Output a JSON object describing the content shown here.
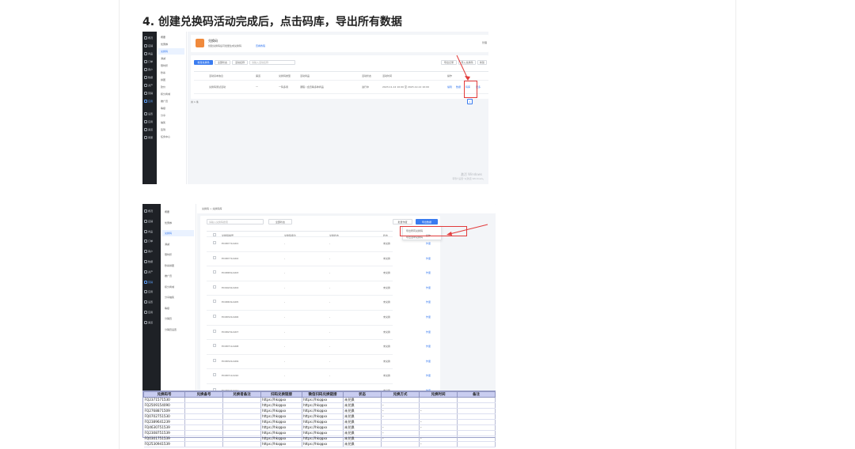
{
  "step_title": "4. 创建兑换码活动完成后，点击码库，导出所有数据",
  "shot1": {
    "nav": [
      "概况",
      "店铺",
      "商品",
      "订单",
      "客户",
      "数据",
      "资产",
      "营销",
      "应用"
    ],
    "nav_active": 8,
    "nav_bottom": [
      "设置",
      "应用",
      "渠道",
      "客服"
    ],
    "subnav": [
      "概要",
      "优惠券",
      "兑换码",
      "满减",
      "限时折",
      "秒杀",
      "拼团",
      "砍价",
      "积分商城",
      "推广员",
      "等级",
      "分享",
      "抽奖",
      "签到",
      "任务中心"
    ],
    "subnav_active": 2,
    "header_title": "兑换码",
    "header_desc": "创建兑换码后可批量生成兑换码",
    "header_link": "查看教程",
    "header_right": "管理",
    "tab_active": "新建兑换码",
    "tab_2": "全部状态",
    "filter_1": "活动名称",
    "search_placeholder": "请输入活动名称",
    "btn_export": "导出记录",
    "btn_import": "导入兑换码",
    "btn_new": "新建",
    "columns": [
      "活动基本信息",
      "渠道",
      "兑换码类型",
      "活动商品",
      "活动状态",
      "活动时间",
      "操作"
    ],
    "row": [
      "兑换码测试活动",
      "一",
      "一码多用",
      "课程 / 会员等多种商品",
      "进行中",
      "2023-11-12 10:00 至 2023-12-12 10:00"
    ],
    "row_actions": [
      "编辑",
      "数据",
      "码库",
      "更多"
    ],
    "pagination": "共 1 条",
    "page_num": "1",
    "watermark_1": "激活 Windows",
    "watermark_2": "转到“设置”以激活 Windows。"
  },
  "shot2": {
    "breadcrumb": "兑换码 > 兑换码库",
    "nav": [
      "概况",
      "店铺",
      "商品",
      "订单",
      "客户",
      "数据",
      "资产",
      "营销",
      "应用",
      "设置",
      "应用",
      "渠道"
    ],
    "nav_active": 7,
    "subnav": [
      "概要",
      "优惠券",
      "兑换码",
      "满减",
      "限时折",
      "秒杀拼团",
      "推广员",
      "积分商城",
      "分享抽奖",
      "等级",
      "分销员",
      "分销员设置"
    ],
    "subnav_active": 2,
    "search_placeholder": "请输入兑换码搜索",
    "status_select": "全部状态",
    "btn_batch": "批量作废",
    "btn_export": "导出数据",
    "dropdown": [
      "导出所有兑换码",
      "导出选中兑换码"
    ],
    "columns": [
      "兑换码编号",
      "兑换码备注",
      "兑换状态",
      "状态",
      "操作"
    ],
    "rows": [
      [
        "EC98771A001",
        "-",
        "-",
        "未兑换",
        "作废"
      ],
      [
        "EC98771A002",
        "-",
        "-",
        "未兑换",
        "作废"
      ],
      [
        "EC98651A003",
        "-",
        "-",
        "未兑换",
        "作废"
      ],
      [
        "EC99241A004",
        "-",
        "-",
        "未兑换",
        "作废"
      ],
      [
        "EC98631A005",
        "-",
        "-",
        "未兑换",
        "作废"
      ],
      [
        "EC98321A006",
        "-",
        "-",
        "未兑换",
        "作废"
      ],
      [
        "EC98231A007",
        "-",
        "-",
        "未兑换",
        "作废"
      ],
      [
        "EC98711A008",
        "-",
        "-",
        "未兑换",
        "作废"
      ],
      [
        "EC98321A009",
        "-",
        "-",
        "未兑换",
        "作废"
      ],
      [
        "EC98711A010",
        "-",
        "-",
        "未兑换",
        "作废"
      ],
      [
        "EC98321A011",
        "-",
        "-",
        "未兑换",
        "作废"
      ]
    ]
  },
  "sheet": {
    "headers": [
      "兑换码号",
      "兑换备号",
      "兑换者备注",
      "扫码兑换链接",
      "微信扫码兑换链接",
      "状态",
      "兑换方式",
      "兑换时间",
      "备注"
    ],
    "rows": [
      [
        "FQ2371571530",
        "",
        "",
        "https://hkqqxx",
        "https://hkqqxx",
        "未兑换",
        "",
        "",
        " "
      ],
      [
        "FQ2509154090",
        "",
        "",
        "https://hkqqxx",
        "https://hkqqxx",
        "未兑换",
        "-",
        "",
        ""
      ],
      [
        "FQ2768871509",
        "",
        "",
        "https://hkqqxx",
        "https://hkqqxx",
        "未兑换",
        "-",
        "-",
        ""
      ],
      [
        "FQ0702751530",
        "",
        "",
        "https://hkqqxx",
        "https://hkqqxx",
        "未兑换",
        "-",
        "",
        ""
      ],
      [
        "FQ2389641239",
        "",
        "",
        "https://hkqqxx",
        "https://hkqqxx",
        "未兑换",
        "",
        "-",
        ""
      ],
      [
        "FQ4630751539",
        "",
        "",
        "https://hkqqxx",
        "https://hkqqxx",
        "未兑换",
        "-",
        "-",
        ""
      ],
      [
        "FQ2308751539",
        "",
        "",
        "https://hkqqxx",
        "https://hkqqxx",
        "未兑换",
        "-",
        "",
        ""
      ],
      [
        "FQ0301751539",
        "",
        "",
        "https://hkqqxx",
        "https://hkqqxx",
        "未兑换",
        "-",
        "-",
        ""
      ],
      [
        "FQ2530941539",
        "",
        "",
        "https://hkqqxx",
        "https://hkqqxx",
        "未兑换",
        "",
        "-",
        ""
      ]
    ]
  }
}
